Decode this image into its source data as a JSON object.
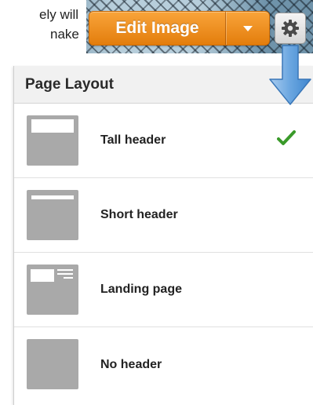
{
  "background_text": {
    "line1": "ely will",
    "line2": "nake"
  },
  "toolbar": {
    "edit_label": "Edit Image",
    "accent_color": "#F39A26"
  },
  "panel": {
    "title": "Page Layout",
    "items": [
      {
        "label": "Tall header",
        "selected": true
      },
      {
        "label": "Short header",
        "selected": false
      },
      {
        "label": "Landing page",
        "selected": false
      },
      {
        "label": "No header",
        "selected": false
      }
    ],
    "check_color": "#3a9a2a"
  },
  "icons": {
    "gear": "gear-icon",
    "caret": "chevron-down-icon",
    "arrow": "arrow-down-icon",
    "check": "checkmark-icon"
  }
}
